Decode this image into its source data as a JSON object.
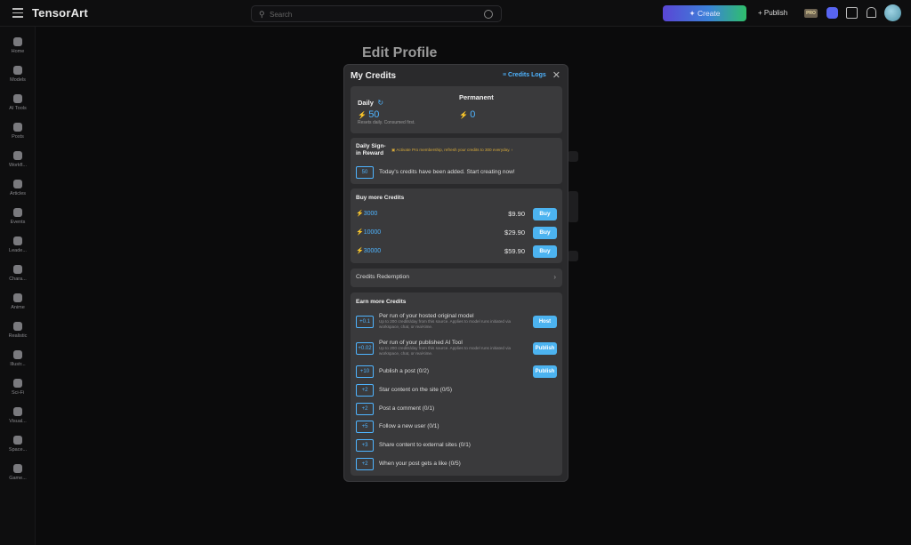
{
  "topbar": {
    "logo": "TensorArt",
    "search_placeholder": "Search",
    "create_label": "Create",
    "publish_label": "Publish",
    "pro_label": "PRO"
  },
  "sidebar": {
    "items": [
      {
        "label": "Home",
        "icon": "home-icon"
      },
      {
        "label": "Models",
        "icon": "models-icon"
      },
      {
        "label": "AI Tools",
        "icon": "ai-tools-icon"
      },
      {
        "label": "Posts",
        "icon": "posts-icon"
      },
      {
        "label": "Workfl...",
        "icon": "workflow-icon"
      },
      {
        "label": "Articles",
        "icon": "articles-icon"
      },
      {
        "label": "Events",
        "icon": "events-icon"
      },
      {
        "label": "Leade...",
        "icon": "leaderboard-icon"
      },
      {
        "label": "Chara...",
        "icon": "character-icon"
      },
      {
        "label": "Anime",
        "icon": "anime-icon"
      },
      {
        "label": "Realistic",
        "icon": "realistic-icon"
      },
      {
        "label": "Illustr...",
        "icon": "illustration-icon"
      },
      {
        "label": "Sci-Fi",
        "icon": "scifi-icon"
      },
      {
        "label": "Visual...",
        "icon": "visual-icon"
      },
      {
        "label": "Space...",
        "icon": "space-icon"
      },
      {
        "label": "Game...",
        "icon": "game-icon"
      }
    ]
  },
  "page": {
    "title": "Edit Profile"
  },
  "modal": {
    "title": "My Credits",
    "logs_label": "Credits Logs",
    "daily": {
      "label": "Daily",
      "value": "50",
      "note": "Resets daily. Consumed first."
    },
    "permanent": {
      "label": "Permanent",
      "value": "0"
    },
    "signin": {
      "title_line1": "Daily Sign-",
      "title_line2": "in Reward",
      "promo": "Activate Pro membership, refresh your credits to 300 everyday.",
      "badge": "50",
      "message": "Today's credits have been added. Start creating now!"
    },
    "buy": {
      "title": "Buy more Credits",
      "items": [
        {
          "amount": "3000",
          "price": "$9.90",
          "button": "Buy"
        },
        {
          "amount": "10000",
          "price": "$29.90",
          "button": "Buy"
        },
        {
          "amount": "30000",
          "price": "$59.90",
          "button": "Buy"
        }
      ]
    },
    "redemption_label": "Credits Redemption",
    "earn": {
      "title": "Earn more Credits",
      "items": [
        {
          "points": "+0.1",
          "title": "Per run of your hosted original model",
          "desc": "Up to 200 credits/day from this source. Applies to model runs initiated via workspace, chat, or real-time.",
          "button": "Host"
        },
        {
          "points": "+0.02",
          "title": "Per run of your published AI Tool",
          "desc": "Up to 200 credits/day from this source. Applies to model runs initiated via workspace, chat, or real-time.",
          "button": "Publish"
        },
        {
          "points": "+10",
          "title": "Publish a post (0/2)",
          "desc": "",
          "button": "Publish"
        },
        {
          "points": "+2",
          "title": "Star content on the site (0/5)",
          "desc": "",
          "button": ""
        },
        {
          "points": "+2",
          "title": "Post a comment (0/1)",
          "desc": "",
          "button": ""
        },
        {
          "points": "+5",
          "title": "Follow a new user (0/1)",
          "desc": "",
          "button": ""
        },
        {
          "points": "+3",
          "title": "Share content to external sites (0/1)",
          "desc": "",
          "button": ""
        },
        {
          "points": "+2",
          "title": "When your post gets a like (0/5)",
          "desc": "",
          "button": ""
        }
      ]
    }
  },
  "colors": {
    "accent": "#4fb4ff",
    "modal_bg": "#2a2a2c",
    "card_bg": "#3a3a3c",
    "promo": "#d6a93a"
  }
}
